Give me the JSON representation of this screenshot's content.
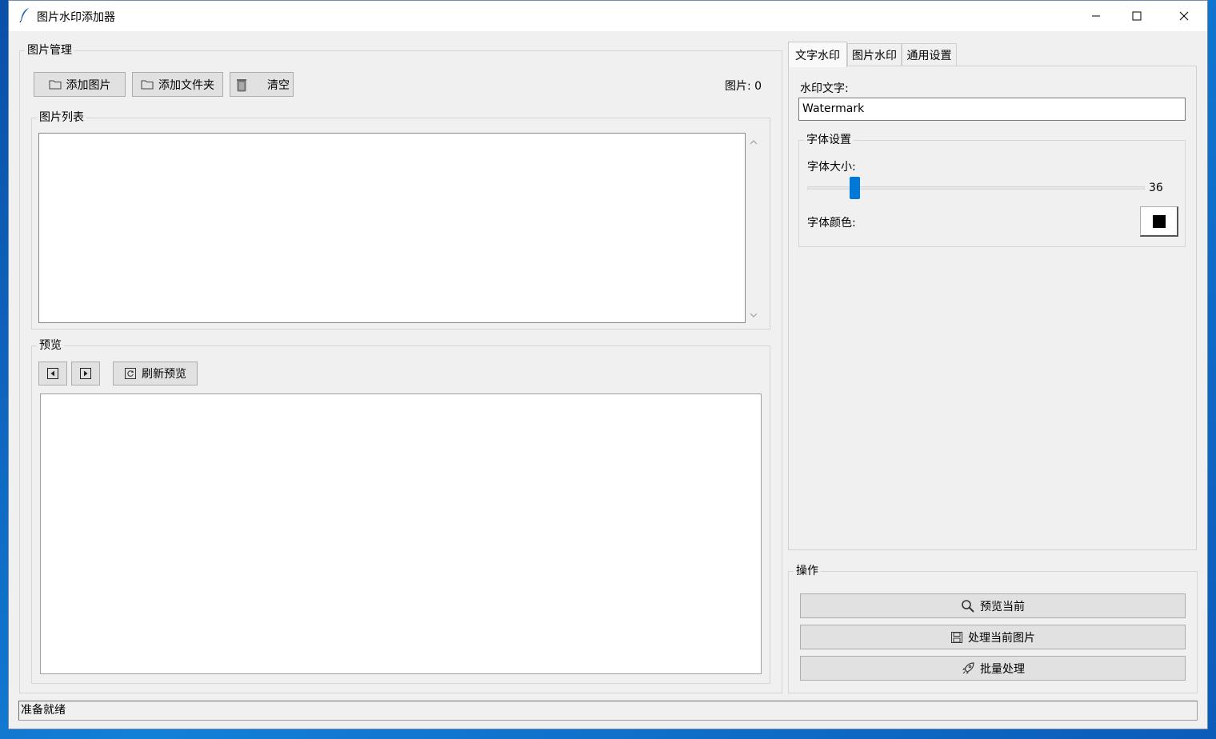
{
  "window": {
    "title": "图片水印添加器"
  },
  "image_management": {
    "legend": "图片管理",
    "add_image_label": "添加图片",
    "add_folder_label": "添加文件夹",
    "clear_label": "清空",
    "count_text": "图片: 0",
    "list_legend": "图片列表"
  },
  "preview": {
    "legend": "预览",
    "refresh_label": "刷新预览"
  },
  "tabs": [
    {
      "label": "文字水印"
    },
    {
      "label": "图片水印"
    },
    {
      "label": "通用设置"
    }
  ],
  "text_watermark": {
    "text_label": "水印文字:",
    "text_value": "Watermark",
    "font_group_legend": "字体设置",
    "font_size_label": "字体大小:",
    "font_size_value": "36",
    "font_size_fraction": 0.13,
    "font_color_label": "字体颜色:",
    "font_color": "#000000"
  },
  "actions": {
    "legend": "操作",
    "preview_current_label": "预览当前",
    "process_current_label": "处理当前图片",
    "batch_label": "批量处理"
  },
  "status": {
    "text": "准备就绪"
  },
  "colors": {
    "accent": "#0078d7",
    "window_bg": "#f0f0f0"
  }
}
